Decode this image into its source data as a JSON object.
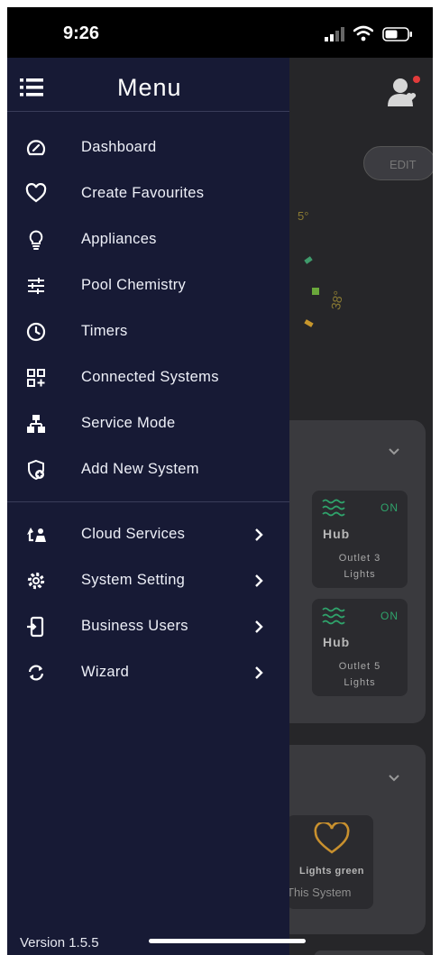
{
  "status_bar": {
    "time": "9:26"
  },
  "drawer": {
    "title": "Menu",
    "version": "Version 1.5.5",
    "items": [
      {
        "label": "Dashboard",
        "icon": "gauge-icon"
      },
      {
        "label": "Create Favourites",
        "icon": "heart-icon"
      },
      {
        "label": "Appliances",
        "icon": "lightbulb-icon"
      },
      {
        "label": "Pool Chemistry",
        "icon": "sliders-icon"
      },
      {
        "label": "Timers",
        "icon": "clock-icon"
      },
      {
        "label": "Connected Systems",
        "icon": "grid-plus-icon"
      },
      {
        "label": "Service Mode",
        "icon": "network-icon"
      },
      {
        "label": "Add New System",
        "icon": "shield-plus-icon"
      }
    ],
    "submenus": [
      {
        "label": "Cloud Services",
        "icon": "cloud-sync-icon"
      },
      {
        "label": "System Setting",
        "icon": "gear-icon"
      },
      {
        "label": "Business Users",
        "icon": "phone-login-icon"
      },
      {
        "label": "Wizard",
        "icon": "refresh-icon"
      }
    ]
  },
  "background": {
    "edit_label": "EDIT",
    "gauge_labels": [
      "5°",
      "38°"
    ],
    "tiles": [
      {
        "status": "ON",
        "name": "Hub",
        "outlet": "Outlet 3",
        "type": "Lights"
      },
      {
        "status": "ON",
        "name": "Hub",
        "outlet": "Outlet 5",
        "type": "Lights"
      }
    ],
    "favourite": {
      "name": "Lights green",
      "system": "This System"
    }
  },
  "colors": {
    "drawer_bg": "#171a35",
    "background_app": "#262629",
    "status_on": "#2fa36b",
    "favourite_heart": "#c8902e",
    "notification_badge": "#e23b3b"
  }
}
